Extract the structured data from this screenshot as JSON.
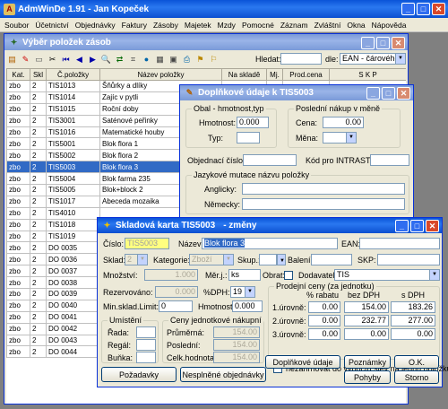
{
  "app": {
    "title": "AdmWinDe 1.91 - Jan Kopeček"
  },
  "menu": [
    "Soubor",
    "Účetnictví",
    "Objednávky",
    "Faktury",
    "Zásoby",
    "Majetek",
    "Mzdy",
    "Pomocné",
    "Záznam",
    "Zvláštní",
    "Okna",
    "Nápověda"
  ],
  "list_window": {
    "title": "Výběr položek zásob",
    "search_label": "Hledat:",
    "search_value": "",
    "by_label": "dle:",
    "by_value": "EAN - čárového",
    "columns": [
      "Kat.",
      "Skl",
      "Č.položky",
      "Název položky",
      "Na skladě",
      "Mj.",
      "Prod.cena",
      "S K P"
    ],
    "rows": [
      [
        "zbo",
        "2",
        "TIS1013",
        "Šňůrky a dlíky"
      ],
      [
        "zbo",
        "2",
        "TIS1014",
        "Zajíc v pytli"
      ],
      [
        "zbo",
        "2",
        "TIS1015",
        "Roční doby"
      ],
      [
        "zbo",
        "2",
        "TIS3001",
        "Saténové peřinky"
      ],
      [
        "zbo",
        "2",
        "TIS1016",
        "Matematické houby"
      ],
      [
        "zbo",
        "2",
        "TIS5001",
        "Blok flora 1"
      ],
      [
        "zbo",
        "2",
        "TIS5002",
        "Blok flora 2"
      ],
      [
        "zbo",
        "2",
        "TIS5003",
        "Blok flora 3"
      ],
      [
        "zbo",
        "2",
        "TIS5004",
        "Blok farma 235"
      ],
      [
        "zbo",
        "2",
        "TIS5005",
        "Blok+block 2"
      ],
      [
        "zbo",
        "2",
        "TIS1017",
        "Abeceda mozaika"
      ],
      [
        "zbo",
        "2",
        "TIS4010",
        ""
      ],
      [
        "zbo",
        "2",
        "TIS1018",
        ""
      ],
      [
        "zbo",
        "2",
        "TIS1019",
        ""
      ],
      [
        "zbo",
        "2",
        "DO 0035",
        ""
      ],
      [
        "zbo",
        "2",
        "DO 0036",
        ""
      ],
      [
        "zbo",
        "2",
        "DO 0037",
        ""
      ],
      [
        "zbo",
        "2",
        "DO 0038",
        ""
      ],
      [
        "zbo",
        "2",
        "DO 0039",
        ""
      ],
      [
        "zbo",
        "2",
        "DO 0040",
        ""
      ],
      [
        "zbo",
        "2",
        "DO 0041",
        ""
      ],
      [
        "zbo",
        "2",
        "DO 0042",
        ""
      ],
      [
        "zbo",
        "2",
        "DO 0043",
        ""
      ],
      [
        "zbo",
        "2",
        "DO 0044",
        ""
      ]
    ],
    "selected_row": 7
  },
  "extra_window": {
    "title": "Doplňkové údaje k TIS5003",
    "group_weight": "Obal - hmotnost,typ",
    "weight_label": "Hmotnost:",
    "weight_value": "0.000",
    "type_label": "Typ:",
    "type_value": "",
    "group_purchase": "Poslední nákup v měně",
    "price_label": "Cena:",
    "price_value": "0.00",
    "currency_label": "Měna:",
    "currency_value": "",
    "order_no_label": "Objednací číslo:",
    "order_no_value": "",
    "intrastat_label": "Kód pro INTRASTAT:",
    "intrastat_value": "",
    "group_lang": "Jazykové mutace názvu položky",
    "en_label": "Anglicky:",
    "de_label": "Německy:"
  },
  "card_window": {
    "title": "Skladová karta TIS5003",
    "title_suffix": "- změny",
    "cislo_label": "Číslo:",
    "cislo_value": "TIS5003",
    "nazev_label": "Název:",
    "nazev_value": "Blok flora 3",
    "ean_label": "EAN:",
    "ean_value": "",
    "sklad_label": "Sklad:",
    "sklad_value": "2",
    "kategorie_label": "Kategorie:",
    "kategorie_value": "Zboží",
    "skup_label": "Skup.:",
    "skup_value": "",
    "baleni_label": "Balení:",
    "baleni_value": "",
    "skp_label": "SKP:",
    "skp_value": "",
    "mnozstvi_label": "Množství:",
    "mnozstvi_value": "1.000",
    "merj_label": "Měr.j.:",
    "merj_value": "ks",
    "obrat_label": "Obrat:",
    "dodavatel_label": "Dodavatel:",
    "dodavatel_value": "TIS",
    "rezervovano_label": "Rezervováno:",
    "rezervovano_value": "0.000",
    "dph_label": "%DPH:",
    "dph_value": "19",
    "minsklad_label": "Min.sklad.Limit:",
    "minsklad_value": "0",
    "hmotnost_label": "Hmotnost:",
    "hmotnost_value": "0.000",
    "prices_group": "Prodejní ceny (za jednotku)",
    "prices_headers": [
      "% rabatu",
      "bez DPH",
      "s DPH"
    ],
    "prices": [
      {
        "label": "1.úrovně:",
        "rabat": "0.00",
        "bez": "154.00",
        "s": "183.26"
      },
      {
        "label": "2.úrovně:",
        "rabat": "0.00",
        "bez": "232.77",
        "s": "277.00"
      },
      {
        "label": "3.úrovně:",
        "rabat": "0.00",
        "bez": "0.00",
        "s": "0.00"
      }
    ],
    "no_discount_label": "nezahrnovat do výpočtu slev na jednu položku",
    "umisteni_group": "Umístění",
    "rada_label": "Řada:",
    "regal_label": "Regál:",
    "bunka_label": "Buňka:",
    "ceny_group": "Ceny jednotkové nákupní",
    "prumerna_label": "Průměrná:",
    "prumerna_value": "154.00",
    "posledni_label": "Poslední:",
    "posledni_value": "154.00",
    "celk_label": "Celk.hodnota:",
    "celk_value": "154.00",
    "btn_pozadavky": "Požadavky",
    "btn_nesplnene": "Nesplněné objednávky",
    "btn_doplnkove": "Doplňkové údaje",
    "btn_poznamky": "Poznámky",
    "btn_ok": "O.K.",
    "btn_pohyby": "Pohyby",
    "btn_storno": "Storno"
  }
}
